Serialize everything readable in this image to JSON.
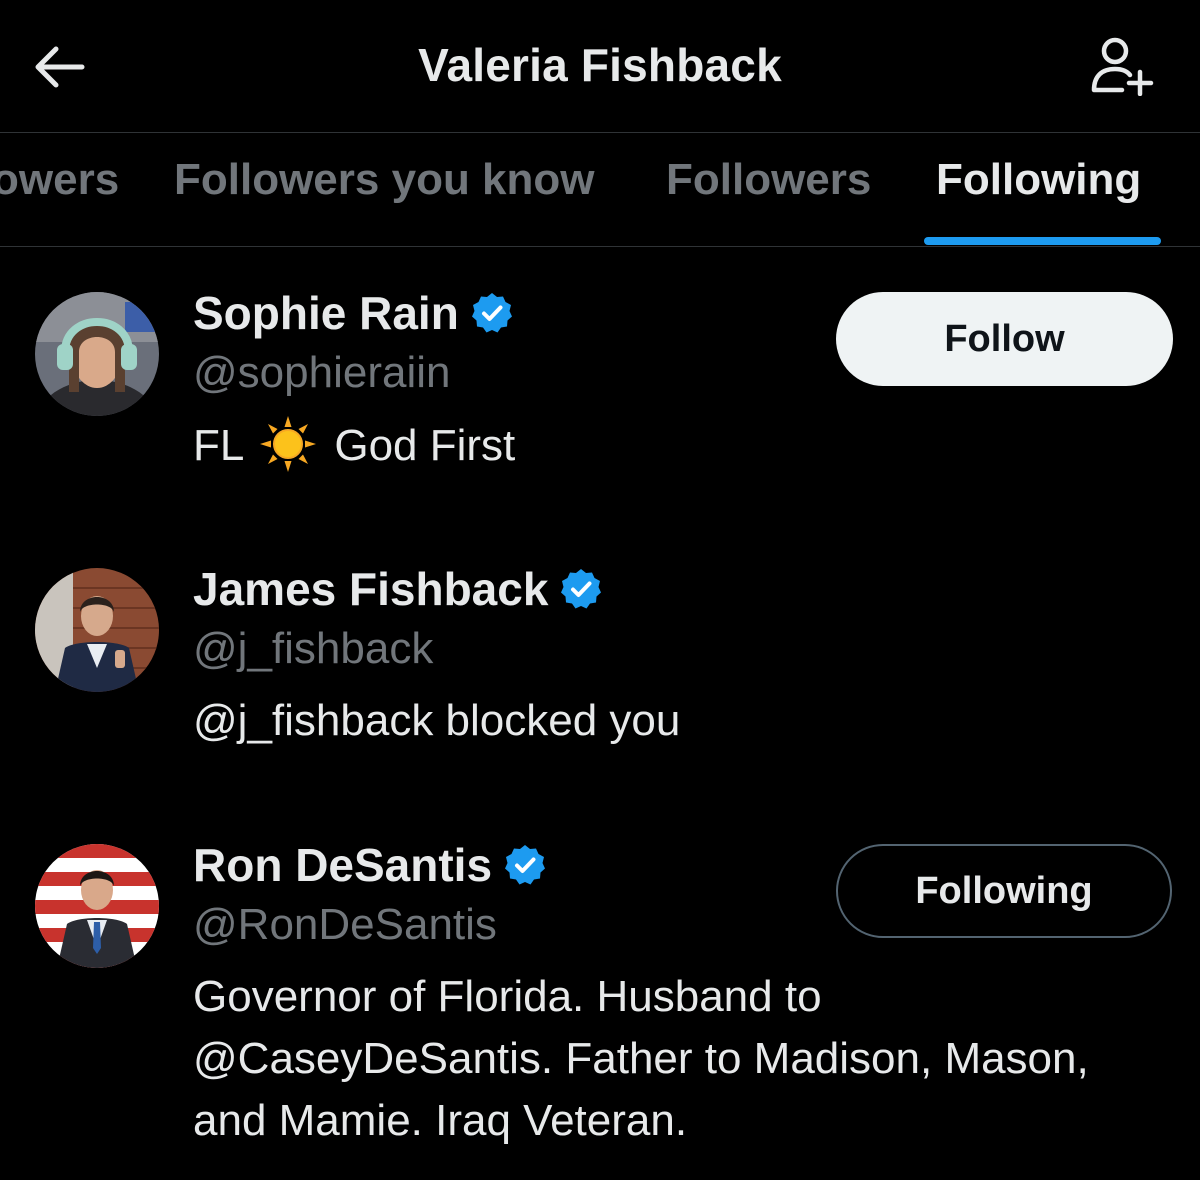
{
  "header": {
    "title": "Valeria Fishback",
    "back_icon": "arrow-left-icon",
    "add_user_icon": "person-plus-icon"
  },
  "tabs": [
    {
      "label": "Verified Followers",
      "visible_label": "owers",
      "active": false
    },
    {
      "label": "Followers you know",
      "active": false
    },
    {
      "label": "Followers",
      "active": false
    },
    {
      "label": "Following",
      "active": true
    }
  ],
  "tab_labels": {
    "partial": "owers",
    "followers_you_know": "Followers you know",
    "followers": "Followers",
    "following": "Following"
  },
  "users": [
    {
      "name": "Sophie Rain",
      "handle": "@sophieraiin",
      "verified": true,
      "bio_before_emoji": "FL",
      "bio_emoji": "sun-emoji",
      "bio_after_emoji": "God First",
      "action_label": "Follow"
    },
    {
      "name": "James Fishback",
      "handle": "@j_fishback",
      "verified": true,
      "bio": "@j_fishback blocked you"
    },
    {
      "name": "Ron DeSantis",
      "handle": "@RonDeSantis",
      "verified": true,
      "bio_lines": [
        "Governor of Florida. Husband to",
        "@CaseyDeSantis. Father to Madison, Mason,",
        "and Mamie. Iraq Veteran."
      ],
      "action_label": "Following"
    }
  ],
  "colors": {
    "background": "#000000",
    "primary_text": "#e7e9ea",
    "secondary_text": "#71767b",
    "accent": "#1d9bf0",
    "divider": "#2f3336",
    "follow_button_bg": "#eff3f4"
  }
}
